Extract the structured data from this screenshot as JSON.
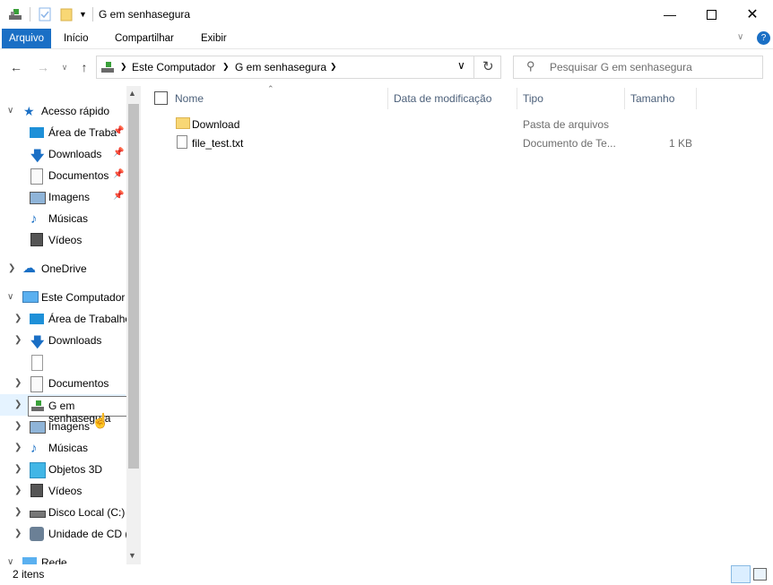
{
  "window": {
    "title": "G em senhasegura",
    "controls": {
      "minimize": "minimize-icon",
      "maximize": "maximize-icon",
      "close": "close-icon"
    }
  },
  "ribbon": {
    "tabs": [
      "Arquivo",
      "Início",
      "Compartilhar",
      "Exibir"
    ]
  },
  "address": {
    "breadcrumb": [
      "Este Computador",
      "G em senhasegura"
    ]
  },
  "search": {
    "placeholder": "Pesquisar G em senhasegura"
  },
  "navpane": {
    "quick_access": "Acesso rápido",
    "quick_items": [
      "Área de Traba",
      "Downloads",
      "Documentos",
      "Imagens",
      "Músicas",
      "Vídeos"
    ],
    "onedrive": "OneDrive",
    "this_pc": "Este Computador",
    "pc_items": [
      "Área de Trabalho",
      "Downloads",
      "",
      "Documentos",
      "G em senhasegura",
      "Imagens",
      "Músicas",
      "Objetos 3D",
      "Vídeos",
      "Disco Local (C:)",
      "Unidade de CD (",
      "Rede"
    ]
  },
  "columns": {
    "name": "Nome",
    "date": "Data de modificação",
    "type": "Tipo",
    "size": "Tamanho"
  },
  "files": [
    {
      "name": "Download",
      "type": "Pasta de arquivos",
      "size": ""
    },
    {
      "name": "file_test.txt",
      "type": "Documento de Te...",
      "size": "1 KB"
    }
  ],
  "status": {
    "count": "2 itens"
  },
  "colors": {
    "accent": "#1a6fc5",
    "folder": "#f8d775"
  }
}
